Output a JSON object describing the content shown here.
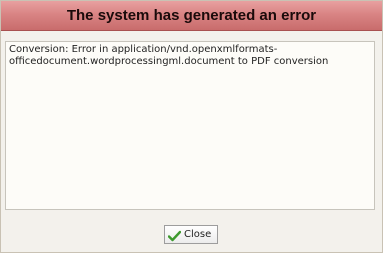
{
  "dialog": {
    "title": "The system has generated an error",
    "message": "Conversion: Error in application/vnd.openxmlformats-\nofficedocument.wordprocessingml.document to PDF conversion",
    "close_button": {
      "label": "Close",
      "icon": "check-icon"
    }
  },
  "colors": {
    "titlebar": "#d98484",
    "background": "#f3f1ec",
    "icon_green": "#3e9a2f"
  }
}
